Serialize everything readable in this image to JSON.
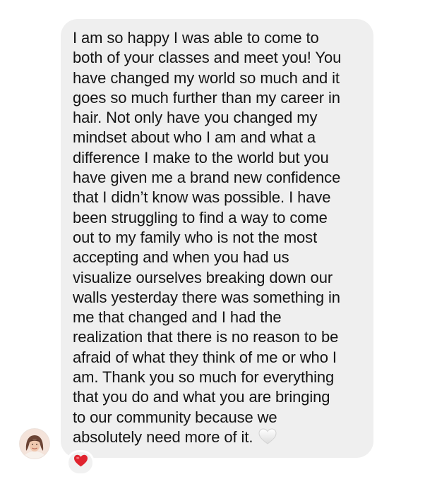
{
  "message": {
    "lines": [
      "I am so happy I was able to come to",
      "both of your classes and meet you! You",
      "have changed my world so much and it",
      "goes so much further than my career in",
      "hair. Not only have you changed my",
      "mindset about who I am and what a",
      "difference I make to the world but you",
      "have given me a brand new confidence",
      "that I didn’t know was possible. I have",
      "been struggling to find a way to come",
      "out to my family who is not the most",
      "accepting and when you had us",
      "visualize ourselves breaking down our",
      "walls yesterday there was something in",
      "me that changed and I had the",
      "realization that there is no reason to be",
      "afraid of what they think of me or who I",
      "am. Thank you so much for everything",
      "that you do and what you are bringing",
      "to our community because we",
      "absolutely need more of it."
    ],
    "trailing_emoji": "white-heart-icon"
  },
  "sender": {
    "avatar_icon": "profile-photo-avatar"
  },
  "reaction": {
    "icon": "red-heart-icon",
    "color": "#e0242f"
  },
  "colors": {
    "bubble_background": "#efefef",
    "text": "#141414",
    "page_background": "#ffffff"
  }
}
